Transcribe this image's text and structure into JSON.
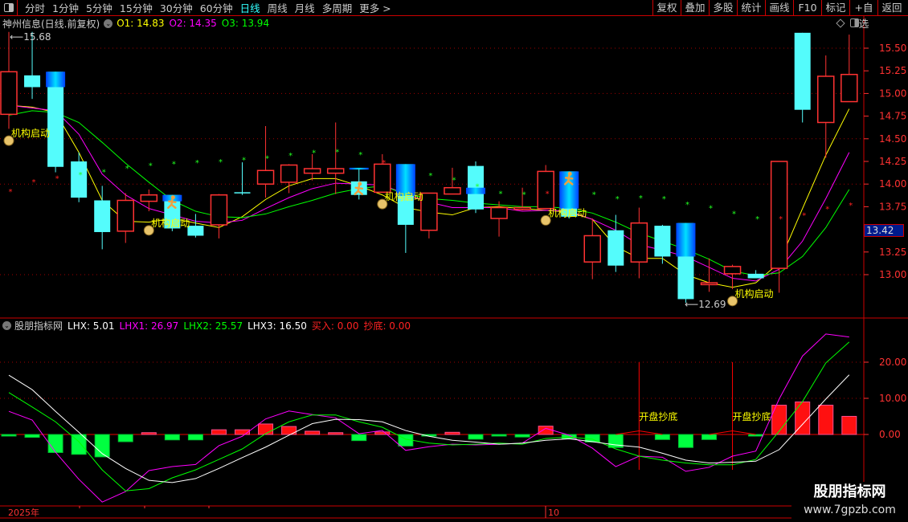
{
  "toolbar": {
    "tabs": [
      "分时",
      "1分钟",
      "5分钟",
      "15分钟",
      "30分钟",
      "60分钟",
      "日线",
      "周线",
      "月线",
      "多周期",
      "更多 >"
    ],
    "active_tab": "日线",
    "right_buttons": [
      "复权",
      "叠加",
      "多股",
      "统计",
      "画线",
      "F10",
      "标记",
      "+自选",
      "返回"
    ]
  },
  "info": {
    "title": "神州信息(日线.前复权)",
    "o1": "O1: 14.83",
    "o2": "O2: 14.35",
    "o3": "O3: 13.94"
  },
  "indicator_info": {
    "name": "股朋指标网",
    "lhx": "LHX: 5.01",
    "lhx1": "LHX1: 26.97",
    "lhx2": "LHX2: 25.57",
    "lhx3": "LHX3: 16.50",
    "buy": "买入: 0.00",
    "bottom": "抄底: 0.00"
  },
  "current_price": "13.42",
  "date_labels": [
    "2025年",
    "10"
  ],
  "watermark": {
    "title": "股朋指标网",
    "url": "www.7gpzb.com"
  },
  "colors": {
    "up": "#ff3232",
    "down": "#54fcfc",
    "ma1": "#ffff00",
    "ma2": "#ff00ff",
    "ma3": "#00ff00",
    "axis": "#ff3232",
    "grid": "#a00000"
  },
  "chart_data": [
    {
      "type": "candlestick",
      "title": "神州信息(日线.前复权)",
      "ylim": [
        12.6,
        15.8
      ],
      "y_ticks": [
        "15.50",
        "15.25",
        "15.00",
        "14.75",
        "14.50",
        "14.25",
        "14.00",
        "13.75",
        "13.25",
        "13.00"
      ],
      "high_label": "15.68",
      "low_label": "12.69",
      "ohlc": [
        [
          14.77,
          15.68,
          14.61,
          15.24
        ],
        [
          15.2,
          15.68,
          14.94,
          15.07
        ],
        [
          15.24,
          15.24,
          14.13,
          14.19
        ],
        [
          14.25,
          14.35,
          13.8,
          13.85
        ],
        [
          13.82,
          13.98,
          13.28,
          13.47
        ],
        [
          13.48,
          13.9,
          13.35,
          13.82
        ],
        [
          13.81,
          13.94,
          13.7,
          13.88
        ],
        [
          13.88,
          13.88,
          13.48,
          13.51
        ],
        [
          13.54,
          13.67,
          13.41,
          13.43
        ],
        [
          13.55,
          13.89,
          13.4,
          13.88
        ],
        [
          13.91,
          14.24,
          13.88,
          13.9
        ],
        [
          14.0,
          14.64,
          13.85,
          14.15
        ],
        [
          14.02,
          14.22,
          13.9,
          14.21
        ],
        [
          14.12,
          14.33,
          14.04,
          14.17
        ],
        [
          14.12,
          14.68,
          13.89,
          14.17
        ],
        [
          14.03,
          14.17,
          13.83,
          13.88
        ],
        [
          13.91,
          14.33,
          13.91,
          14.22
        ],
        [
          14.22,
          14.22,
          13.24,
          13.55
        ],
        [
          13.49,
          13.9,
          13.4,
          13.9
        ],
        [
          13.89,
          14.18,
          13.89,
          13.96
        ],
        [
          14.2,
          14.25,
          13.68,
          13.72
        ],
        [
          13.62,
          13.81,
          13.42,
          13.74
        ],
        [
          13.72,
          13.96,
          13.71,
          13.74
        ],
        [
          13.73,
          14.21,
          13.73,
          14.14
        ],
        [
          14.14,
          14.14,
          13.62,
          13.64
        ],
        [
          13.14,
          13.62,
          12.95,
          13.43
        ],
        [
          13.49,
          13.66,
          13.03,
          13.1
        ],
        [
          13.14,
          13.74,
          12.96,
          13.57
        ],
        [
          13.54,
          13.55,
          13.12,
          13.2
        ],
        [
          13.57,
          13.57,
          12.69,
          12.73
        ],
        [
          12.89,
          13.18,
          12.81,
          12.91
        ],
        [
          13.01,
          13.11,
          12.84,
          13.09
        ],
        [
          13.01,
          13.05,
          12.96,
          12.96
        ],
        [
          13.07,
          14.25,
          12.8,
          14.25
        ],
        [
          15.67,
          15.67,
          14.68,
          14.82
        ],
        [
          14.68,
          15.42,
          14.29,
          15.19
        ],
        [
          14.91,
          15.65,
          14.91,
          15.21
        ]
      ],
      "highlight_bands": [
        [
          2,
          15.24,
          15.07
        ],
        [
          7,
          13.88,
          13.81
        ],
        [
          15,
          14.18,
          14.16
        ],
        [
          17,
          14.22,
          13.87
        ],
        [
          20,
          13.96,
          13.89
        ],
        [
          24,
          14.14,
          13.73
        ],
        [
          29,
          13.57,
          13.2
        ]
      ],
      "series": [
        {
          "name": "O1",
          "values": [
            14.87,
            14.85,
            14.79,
            14.35,
            13.82,
            13.59,
            13.58,
            13.62,
            13.57,
            13.52,
            13.64,
            13.83,
            13.98,
            14.06,
            14.06,
            13.98,
            13.88,
            13.74,
            13.69,
            13.66,
            13.74,
            13.75,
            13.73,
            13.71,
            13.69,
            13.61,
            13.31,
            13.18,
            13.18,
            13.0,
            12.91,
            12.86,
            12.91,
            13.13,
            13.73,
            14.32,
            14.83
          ]
        },
        {
          "name": "O2",
          "values": [
            14.87,
            14.84,
            14.81,
            14.55,
            14.11,
            13.88,
            13.73,
            13.66,
            13.59,
            13.57,
            13.6,
            13.73,
            13.85,
            13.95,
            14.01,
            14.0,
            13.99,
            13.89,
            13.8,
            13.74,
            13.74,
            13.74,
            13.7,
            13.71,
            13.7,
            13.61,
            13.49,
            13.33,
            13.27,
            13.2,
            13.08,
            12.96,
            12.93,
            13.06,
            13.37,
            13.84,
            14.35
          ]
        },
        {
          "name": "O3",
          "values": [
            14.76,
            14.81,
            14.79,
            14.68,
            14.46,
            14.23,
            14.02,
            13.82,
            13.7,
            13.64,
            13.63,
            13.67,
            13.75,
            13.82,
            13.9,
            13.95,
            13.98,
            13.89,
            13.84,
            13.82,
            13.79,
            13.77,
            13.75,
            13.75,
            13.73,
            13.68,
            13.58,
            13.46,
            13.37,
            13.28,
            13.17,
            13.04,
            12.99,
            13.02,
            13.2,
            13.52,
            13.94
          ]
        }
      ],
      "stars": [
        [
          13.92,
          "r"
        ],
        [
          14.03,
          "r"
        ],
        [
          14.07,
          "r"
        ],
        [
          14.11,
          "g"
        ],
        [
          14.14,
          "g"
        ],
        [
          14.18,
          "g"
        ],
        [
          14.21,
          "g"
        ],
        [
          14.23,
          "g"
        ],
        [
          14.24,
          "g"
        ],
        [
          14.25,
          "g"
        ],
        [
          14.27,
          "g"
        ],
        [
          14.29,
          "g"
        ],
        [
          14.32,
          "g"
        ],
        [
          14.35,
          "g"
        ],
        [
          14.36,
          "g"
        ],
        [
          14.33,
          "g"
        ],
        [
          14.24,
          "r"
        ],
        null,
        [
          14.1,
          "g"
        ],
        [
          14.05,
          "g"
        ],
        [
          13.98,
          "g"
        ],
        [
          13.9,
          "g"
        ],
        [
          13.89,
          "g"
        ],
        [
          13.9,
          "r"
        ],
        null,
        [
          13.89,
          "g"
        ],
        [
          13.84,
          "g"
        ],
        [
          13.85,
          "g"
        ],
        [
          13.84,
          "g"
        ],
        [
          13.78,
          "g"
        ],
        [
          13.74,
          "g"
        ],
        [
          13.68,
          "g"
        ],
        [
          13.62,
          "g"
        ],
        [
          13.62,
          "r"
        ],
        [
          13.66,
          "r"
        ],
        [
          13.73,
          "r"
        ],
        [
          13.77,
          "r"
        ]
      ],
      "signals": [
        {
          "index": 0,
          "label": "机构启动",
          "price": 14.55
        },
        {
          "index": 6,
          "label": "机构启动",
          "price": 13.56
        },
        {
          "index": 16,
          "label": "机构启动",
          "price": 13.85
        },
        {
          "index": 23,
          "label": "机构启动",
          "price": 13.67
        },
        {
          "index": 31,
          "label": "机构启动",
          "price": 12.78
        }
      ],
      "runner_icons": [
        7,
        15,
        24
      ]
    },
    {
      "type": "bar+line",
      "title": "股朋指标网",
      "ylim": [
        -19,
        32
      ],
      "y_ticks": [
        "20.00",
        "10.00",
        "0.00"
      ],
      "bars": {
        "name": "LHX",
        "values": [
          -0.2,
          -0.8,
          -5.0,
          -5.5,
          -6.2,
          -2.0,
          0.5,
          -1.5,
          -1.5,
          1.3,
          1.3,
          2.9,
          2.2,
          0.9,
          0.5,
          -1.7,
          0.7,
          -3.2,
          -0.3,
          0.6,
          -1.3,
          -0.3,
          -0.7,
          2.3,
          -1.2,
          -2.1,
          -3.6,
          0,
          -1.4,
          -3.6,
          -1.4,
          0,
          -0.4,
          8.1,
          9.0,
          8.1,
          5.01
        ]
      },
      "series": [
        {
          "name": "LHX1",
          "values": [
            6.4,
            4.0,
            -4.9,
            -12.4,
            -18.7,
            -15.8,
            -10.0,
            -8.9,
            -8.3,
            -3.1,
            -0.5,
            4.3,
            6.5,
            5.5,
            4.6,
            0.2,
            1.1,
            -4.4,
            -3.4,
            -2.7,
            -2.9,
            -2.7,
            -2.4,
            1.7,
            -0.2,
            -3.8,
            -8.9,
            -6.0,
            -6.3,
            -10.2,
            -9.1,
            -6.0,
            -4.6,
            9.8,
            21.7,
            27.8,
            26.97
          ]
        },
        {
          "name": "LHX2",
          "values": [
            11.6,
            7.6,
            3.5,
            -2.0,
            -9.8,
            -15.6,
            -15.0,
            -12.0,
            -9.8,
            -6.9,
            -4.0,
            0.2,
            3.5,
            5.4,
            5.4,
            3.5,
            2.0,
            -1.3,
            -2.4,
            -2.9,
            -2.7,
            -2.4,
            -2.7,
            -1.1,
            -0.7,
            -1.3,
            -4.0,
            -6.0,
            -7.1,
            -7.9,
            -8.4,
            -8.4,
            -6.9,
            0.9,
            9.1,
            19.8,
            25.57
          ]
        },
        {
          "name": "LHX3",
          "values": [
            16.4,
            12.4,
            6.4,
            0.6,
            -5.3,
            -9.4,
            -12.7,
            -13.3,
            -12.2,
            -9.4,
            -6.4,
            -3.5,
            -0.2,
            3.0,
            4.2,
            4.1,
            3.5,
            1.1,
            -0.5,
            -1.6,
            -2.1,
            -2.7,
            -2.4,
            -1.6,
            -1.2,
            -2.0,
            -2.9,
            -3.5,
            -5.2,
            -7.1,
            -7.9,
            -7.7,
            -7.4,
            -4.2,
            2.8,
            9.8,
            16.5
          ]
        }
      ],
      "markers": [
        {
          "index": 27,
          "label": "开盘抄底"
        },
        {
          "index": 31,
          "label": "开盘抄底"
        }
      ]
    }
  ]
}
